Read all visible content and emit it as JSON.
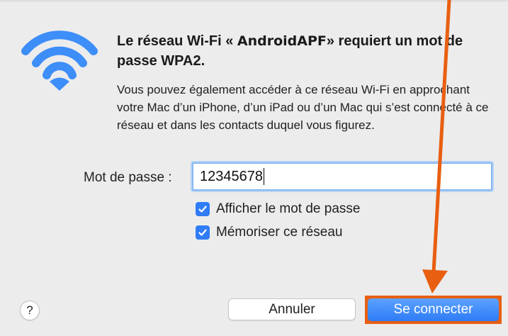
{
  "dialog": {
    "title_prefix": "Le réseau Wi-Fi « ",
    "network_name": "AndroidAPF",
    "title_suffix": "» requiert un mot de passe WPA2.",
    "description": "Vous pouvez également accéder à ce réseau Wi-Fi en approchant votre Mac d’un iPhone, d’un iPad ou d’un Mac qui s’est connecté à ce réseau et dans les contacts duquel vous figurez.",
    "password_label": "Mot de passe :",
    "password_value": "12345678",
    "show_password_label": "Afficher le mot de passe",
    "show_password_checked": true,
    "remember_network_label": "Mémoriser ce réseau",
    "remember_network_checked": true,
    "help_label": "?",
    "cancel_label": "Annuler",
    "connect_label": "Se connecter"
  },
  "icons": {
    "wifi": "wifi-icon",
    "checkmark": "checkmark-icon",
    "annotation_arrow": "arrow-down-icon"
  },
  "colors": {
    "accent": "#2f7cf6",
    "wifi_icon": "#3d8ef8",
    "annotation": "#e85f12",
    "dialog_bg": "#ececec"
  }
}
